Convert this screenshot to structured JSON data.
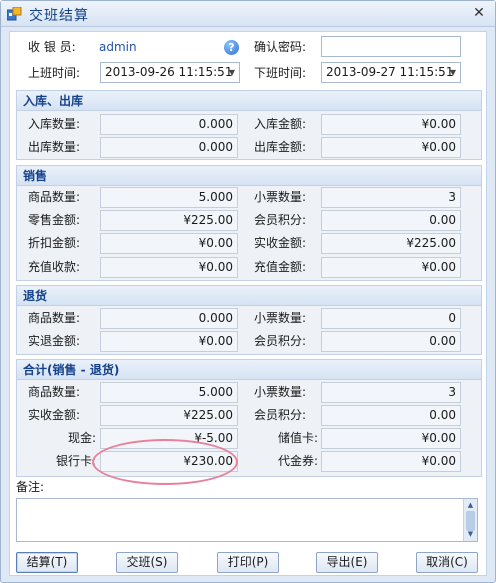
{
  "window": {
    "title": "交班结算",
    "close_glyph": "✕"
  },
  "header": {
    "cashier_label": "收 银 员:",
    "cashier_value": "admin",
    "confirm_pwd_label": "确认密码:",
    "confirm_pwd_value": "",
    "start_time_label": "上班时间:",
    "start_time_value": "2013-09-26 11:15:51",
    "end_time_label": "下班时间:",
    "end_time_value": "2013-09-27 11:15:51"
  },
  "stock": {
    "title": "入库、出库",
    "in_qty_label": "入库数量:",
    "in_qty": "0.000",
    "in_amt_label": "入库金额:",
    "in_amt": "¥0.00",
    "out_qty_label": "出库数量:",
    "out_qty": "0.000",
    "out_amt_label": "出库金额:",
    "out_amt": "¥0.00"
  },
  "sales": {
    "title": "销售",
    "qty_label": "商品数量:",
    "qty": "5.000",
    "tickets_label": "小票数量:",
    "tickets": "3",
    "retail_label": "零售金额:",
    "retail": "¥225.00",
    "points_label": "会员积分:",
    "points": "0.00",
    "discount_label": "折扣金额:",
    "discount": "¥0.00",
    "received_label": "实收金额:",
    "received": "¥225.00",
    "recharge_recv_label": "充值收款:",
    "recharge_recv": "¥0.00",
    "recharge_amt_label": "充值金额:",
    "recharge_amt": "¥0.00"
  },
  "returns": {
    "title": "退货",
    "qty_label": "商品数量:",
    "qty": "0.000",
    "tickets_label": "小票数量:",
    "tickets": "0",
    "refund_label": "实退金额:",
    "refund": "¥0.00",
    "points_label": "会员积分:",
    "points": "0.00"
  },
  "total": {
    "title": "合计(销售 - 退货)",
    "qty_label": "商品数量:",
    "qty": "5.000",
    "tickets_label": "小票数量:",
    "tickets": "3",
    "received_label": "实收金额:",
    "received": "¥225.00",
    "points_label": "会员积分:",
    "points": "0.00",
    "cash_label": "现金:",
    "cash": "¥-5.00",
    "stored_card_label": "储值卡:",
    "stored_card": "¥0.00",
    "bank_card_label": "银行卡:",
    "bank_card": "¥230.00",
    "voucher_label": "代金券:",
    "voucher": "¥0.00"
  },
  "remark": {
    "label": "备注:",
    "value": ""
  },
  "buttons": {
    "settle": "结算(T)",
    "handover": "交班(S)",
    "print": "打印(P)",
    "export": "导出(E)",
    "cancel": "取消(C)"
  },
  "colors": {
    "title_text": "#15428b",
    "annotation": "#e8809a",
    "admin_text": "#2252a8"
  },
  "icons": {
    "app": "app-icon",
    "help": "help-icon",
    "close": "close-icon",
    "dropdown": "dropdown-arrow-icon"
  }
}
